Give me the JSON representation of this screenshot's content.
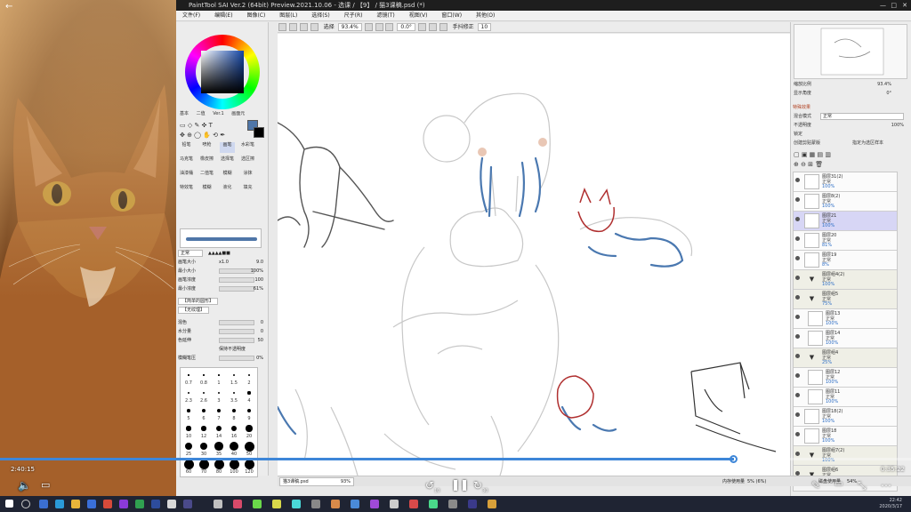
{
  "video": {
    "back_label": "←",
    "elapsed": "2:40:15",
    "remaining": "0:35:22",
    "progress_fraction": 0.806,
    "rewind_label": "10",
    "forward_label": "30"
  },
  "window": {
    "title": "PaintTool SAI Ver.2 (64bit) Preview.2021.10.06 - 选课 / 【9】 / 猫3课稿.psd (*)"
  },
  "menu": [
    "文件(F)",
    "编辑(E)",
    "图像(C)",
    "图层(L)",
    "选择(S)",
    "尺子(R)",
    "滤镜(T)",
    "视图(V)",
    "窗口(W)",
    "其他(O)"
  ],
  "toolbar": {
    "select_label": "选择",
    "zoom": "93.4%",
    "angle": "0.0°",
    "stabilizer_label": "手抖修正",
    "stabilizer_value": "10"
  },
  "color_tabs": [
    "基本",
    "二值",
    "Ver.1",
    "画面元"
  ],
  "brush_tools": [
    "铅笔",
    "喷枪",
    "画笔",
    "水彩笔",
    "马克笔",
    "橡皮擦",
    "选择笔",
    "选区擦",
    "油漆桶",
    "二值笔",
    "模糊",
    "涂抹",
    "特效笔",
    "模糊",
    "液化",
    "填充"
  ],
  "brush_params": {
    "mode": "正常",
    "size_label": "画笔大小",
    "size_mult": "x1.0",
    "size_value": "9.0",
    "min_size_label": "最小大小",
    "min_size_value": "100%",
    "density_label": "画笔浓度",
    "density_value": "100",
    "min_density_label": "最小浓度",
    "min_density_value": "61%",
    "shape_label": "【简单的圆形】",
    "texture_label": "【无纹理】",
    "blend_label": "混色",
    "blend_value": "0",
    "water_label": "水分量",
    "water_value": "0",
    "hold_label": "色延伸",
    "hold_value": "50",
    "keep_opacity_label": "保持不透明度",
    "blur_label": "模糊笔压",
    "blur_value": "0%"
  },
  "brush_sizes": [
    "0.7",
    "0.8",
    "1",
    "1.5",
    "2",
    "2.3",
    "2.6",
    "3",
    "3.5",
    "4",
    "5",
    "6",
    "7",
    "8",
    "9",
    "10",
    "12",
    "14",
    "16",
    "20",
    "25",
    "30",
    "35",
    "40",
    "50",
    "60",
    "70",
    "80",
    "100",
    "120"
  ],
  "navigator": {
    "zoom_label": "缩放比例",
    "zoom_value": "93.4%",
    "angle_label": "显示角度",
    "angle_value": "0°"
  },
  "layer_panel": {
    "effects_label": "特殊效果",
    "blend_mode_label": "混合模式",
    "blend_mode_value": "正常",
    "opacity_label": "不透明度",
    "opacity_value": "100%",
    "lock_label": "锁定",
    "clip_label": "创建剪贴蒙版",
    "source_label": "指定为选区样本"
  },
  "layers": [
    {
      "name": "图层31(2)",
      "mode": "正常",
      "opacity": "100%",
      "type": "layer"
    },
    {
      "name": "图层8(2)",
      "mode": "正常",
      "opacity": "100%",
      "type": "layer"
    },
    {
      "name": "图层21",
      "mode": "正常",
      "opacity": "100%",
      "type": "selected"
    },
    {
      "name": "图层20",
      "mode": "正常",
      "opacity": "81%",
      "type": "layer"
    },
    {
      "name": "图层19",
      "mode": "正常",
      "opacity": "8%",
      "type": "layer"
    },
    {
      "name": "图层组4(2)",
      "mode": "正常",
      "opacity": "100%",
      "type": "folder"
    },
    {
      "name": "图层组5",
      "mode": "正常",
      "opacity": "75%",
      "type": "folder"
    },
    {
      "name": "图层13",
      "mode": "正常",
      "opacity": "100%",
      "type": "child"
    },
    {
      "name": "图层14",
      "mode": "正常",
      "opacity": "100%",
      "type": "child"
    },
    {
      "name": "图层组4",
      "mode": "正常",
      "opacity": "25%",
      "type": "folder"
    },
    {
      "name": "图层12",
      "mode": "正常",
      "opacity": "100%",
      "type": "child"
    },
    {
      "name": "图层11",
      "mode": "正常",
      "opacity": "100%",
      "type": "child"
    },
    {
      "name": "图层18(2)",
      "mode": "正常",
      "opacity": "100%",
      "type": "layer"
    },
    {
      "name": "图层18",
      "mode": "正常",
      "opacity": "100%",
      "type": "layer"
    },
    {
      "name": "图层组7(2)",
      "mode": "正常",
      "opacity": "100%",
      "type": "folder"
    },
    {
      "name": "图层组6",
      "mode": "正常",
      "opacity": "100%",
      "type": "folder"
    }
  ],
  "status": {
    "doc_name": "猫3课稿.psd",
    "doc_zoom": "93%",
    "memory_label": "内存使用量",
    "memory_value": "5% (6%)",
    "disk_label": "磁盘使用量",
    "disk_value": "54%"
  },
  "taskbar": {
    "time": "22:42",
    "date": "2020/3/17"
  },
  "colors": {
    "accent_blue": "#3d86d8",
    "brush_blue": "#4f76a8",
    "sketch_red": "#b03030",
    "layer_selected": "#d7d6f5"
  }
}
